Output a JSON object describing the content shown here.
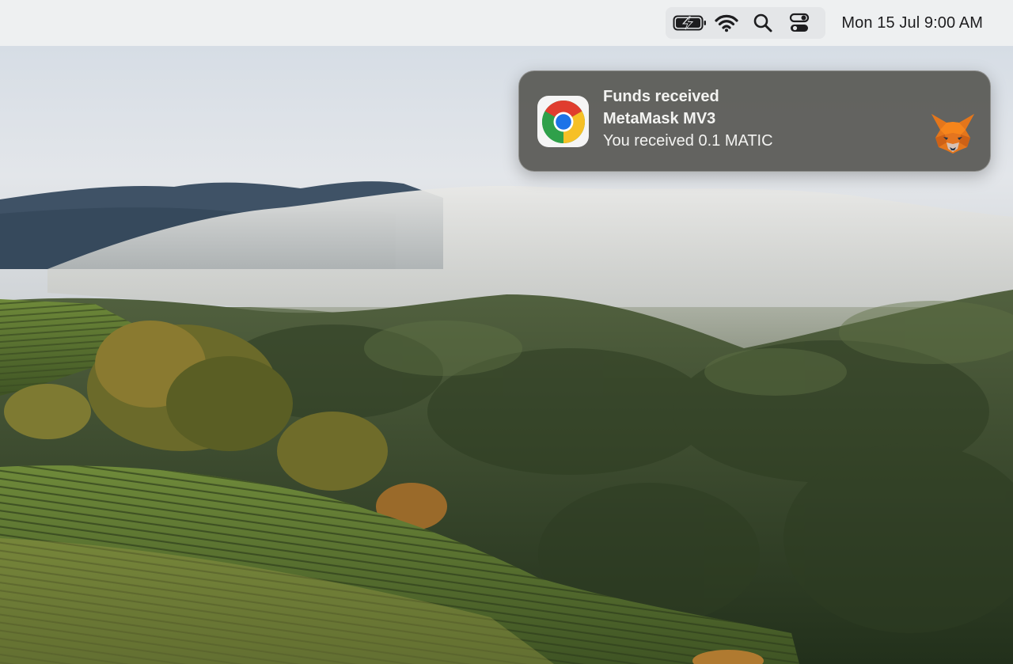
{
  "menubar": {
    "icons": [
      "battery-charging-icon",
      "wifi-icon",
      "search-icon",
      "control-center-icon"
    ],
    "clock": "Mon 15 Jul 9:00 AM"
  },
  "notification": {
    "app_icon": "chrome-icon",
    "title": "Funds received",
    "subtitle": "MetaMask MV3",
    "body": "You received 0.1 MATIC",
    "attachment_icon": "metamask-fox-icon"
  },
  "colors": {
    "menubar_bg": "#eef0f1",
    "notification_bg": "#585854",
    "notification_text": "#f3f3f1"
  }
}
